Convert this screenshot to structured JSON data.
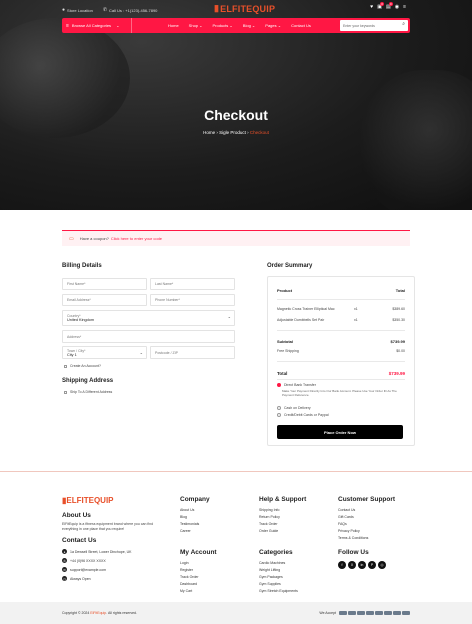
{
  "topbar": {
    "store_locator": "Store Location",
    "call_us": "Call Us : +1(123)-456-7890",
    "cart_count": "0",
    "wishlist_count": "0"
  },
  "logo": {
    "mark": "E",
    "text": "ELFITEQUIP"
  },
  "nav": {
    "browse": "Browse All Categories",
    "links": [
      "Home",
      "Shop",
      "Products",
      "Blog",
      "Pages",
      "Contact Us"
    ],
    "search_placeholder": "Enter your keywords"
  },
  "hero": {
    "title": "Checkout",
    "crumb_home": "Home",
    "crumb_mid": "Sigle Product",
    "crumb_current": "Checkout"
  },
  "coupon": {
    "text": "Have a coupon?",
    "link": "Click here to enter your code"
  },
  "billing": {
    "title": "Billing Details",
    "first_name": "First Name*",
    "last_name": "Last Name*",
    "email": "Email Address*",
    "phone": "Phone Number*",
    "country_label": "Country*",
    "country_value": "United Kingdom",
    "address": "Address*",
    "city_label": "Town / City*",
    "city_value": "City 1",
    "postcode": "Postcode / ZIP",
    "create_account": "Create An Account?"
  },
  "shipping": {
    "title": "Shipping Address",
    "different": "Ship To A Different Address"
  },
  "order": {
    "title": "Order Summary",
    "product_h": "Product",
    "total_h": "Total",
    "items": [
      {
        "name": "Magnetic Cross Trainer Elliptical Mac",
        "qty": "x1",
        "price": "$389.60"
      },
      {
        "name": "Adjustable Dumbbells Set Pair",
        "qty": "x1",
        "price": "$350.30"
      }
    ],
    "subtotal_label": "Subtotal",
    "subtotal": "$739.99",
    "shipping_label": "Free Shipping",
    "shipping": "$0.00",
    "total_label": "Total",
    "total": "$739.99",
    "pay_direct": "Direct Bank Transfer",
    "pay_direct_desc": "Make Your Payment Directly Into Our Bank Account. Please Use Your Order ID As The Payment Reference.",
    "pay_cod": "Cash on Delivery",
    "pay_card": "Credit/Debit Cards or Paypal",
    "place_order": "Place Order Now",
    "accent": "#ff1744"
  },
  "footer": {
    "logo": "ELFITEQUIP",
    "about_h": "About Us",
    "about": "ElFitEquip is a fitness equipment brand where you can find everything in one place that you require!",
    "contact_h": "Contact Us",
    "address": "1a Dewsell Street, Lower Dinchope, UK",
    "phone": "+44 (0)96 XXXX XXXX",
    "email": "support@example.com",
    "hours": "Always Open",
    "company_h": "Company",
    "company": [
      "About Us",
      "Blog",
      "Testimonials",
      "Career"
    ],
    "help_h": "Help & Support",
    "help": [
      "Shipping Info",
      "Return Policy",
      "Track Order",
      "Order Guide"
    ],
    "customer_h": "Customer Support",
    "customer": [
      "Contact Us",
      "Gift Cards",
      "FAQs",
      "Privacy Policy",
      "Terms & Conditions"
    ],
    "account_h": "My Account",
    "account": [
      "Login",
      "Register",
      "Track Order",
      "Dashboard",
      "My Cart"
    ],
    "categories_h": "Categories",
    "categories": [
      "Cardio Machines",
      "Weight Lifting",
      "Gym Packages",
      "Gym Supplies",
      "Gym Stretch Equipments"
    ],
    "follow_h": "Follow Us",
    "social": [
      "f",
      "X",
      "in",
      "P",
      "◎"
    ],
    "copyright_pre": "Copyright © 2024",
    "copyright_brand": "ElFitEquip",
    "copyright_post": ". All rights reserved.",
    "pay_label": "We Accept"
  }
}
